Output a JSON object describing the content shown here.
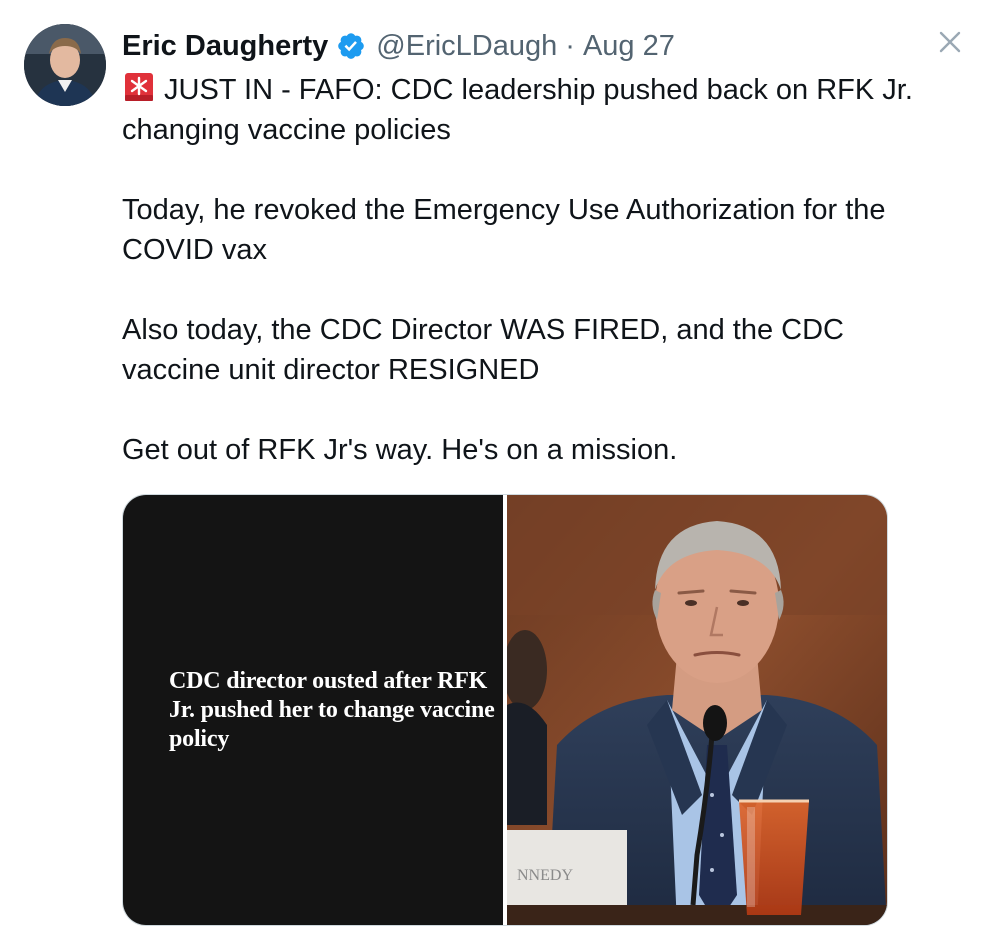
{
  "tweet": {
    "author": {
      "display_name": "Eric Daugherty",
      "handle": "@EricLDaugh",
      "verified_icon": "verified-badge-icon",
      "avatar": "profile-photo"
    },
    "separator": "·",
    "date": "Aug 27",
    "close_icon": "close-icon",
    "text": {
      "line1_icon": "siren-emoji-icon",
      "paragraph1": "JUST IN - FAFO: CDC leadership pushed back on RFK Jr. changing vaccine policies",
      "paragraph2": "Today, he revoked the Emergency Use Authorization for the COVID vax",
      "paragraph3": "Also today, the CDC Director WAS FIRED, and the CDC vaccine unit director RESIGNED",
      "paragraph4": "Get out of RFK Jr's way. He's on a mission."
    },
    "media": {
      "left_headline": "CDC director ousted after RFK Jr. pushed her to change vaccine policy",
      "right_image": "photo of man in suit at hearing with microphone and iced tea",
      "nameplate_text": "NNEDY"
    },
    "colors": {
      "text": "#0f1419",
      "muted": "#536471",
      "verified_blue": "#1d9bf0",
      "border": "#cfd9de",
      "headline_bg": "#141414"
    }
  }
}
